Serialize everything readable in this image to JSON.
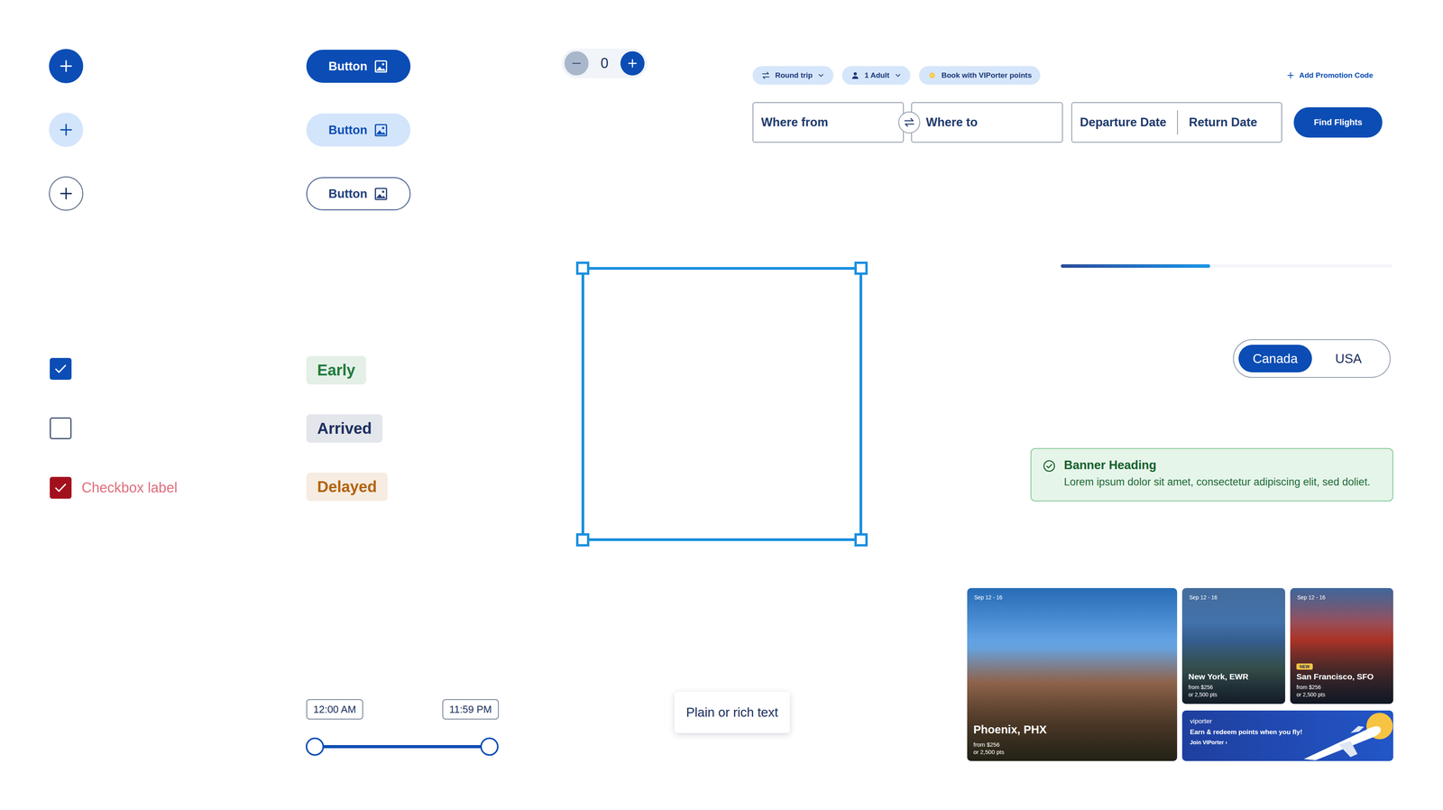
{
  "icon_buttons": [
    {
      "kind": "filled"
    },
    {
      "kind": "tonal"
    },
    {
      "kind": "outlined"
    }
  ],
  "checkboxes": [
    {
      "checked": true,
      "invalid": false,
      "label": ""
    },
    {
      "checked": false,
      "invalid": false,
      "label": ""
    },
    {
      "checked": true,
      "invalid": true,
      "label": "Checkbox label"
    }
  ],
  "buttons": [
    {
      "label": "Button",
      "kind": "filled"
    },
    {
      "label": "Button",
      "kind": "tonal"
    },
    {
      "label": "Button",
      "kind": "outlined"
    }
  ],
  "status_tags": [
    {
      "label": "Early",
      "color": "#1e7a3c"
    },
    {
      "label": "Arrived",
      "color": "#1b2f5e"
    },
    {
      "label": "Delayed",
      "color": "#b3630b"
    }
  ],
  "stepper": {
    "value": "0",
    "decrement_disabled": true
  },
  "time_range": {
    "start": "12:00 AM",
    "end": "11:59 PM",
    "start_level": 0,
    "end_level": 1
  },
  "selection_box": {
    "selected": true
  },
  "tooltip": {
    "text": "Plain or rich text"
  },
  "flight_search": {
    "chips": [
      {
        "label": "Round trip",
        "kind": "trip"
      },
      {
        "label": "1 Adult",
        "kind": "passengers"
      },
      {
        "label": "Book with VIPorter points",
        "kind": "points"
      }
    ],
    "promo": "Add Promotion Code",
    "from": "Where from",
    "to": "Where to",
    "dates": [
      "Departure Date",
      "Return Date"
    ],
    "submit": "Find Flights"
  },
  "progress": {
    "level": 0.45
  },
  "country_toggle": [
    {
      "label": "Canada",
      "selected": true
    },
    {
      "label": "USA",
      "selected": false
    }
  ],
  "banner": {
    "heading": "Banner Heading",
    "body": "Lorem ipsum dolor sit amet, consectetur adipiscing elit, sed doliet."
  },
  "destinations": [
    {
      "kind": "large",
      "dates": "Sep 12 - 16",
      "city": "Phoenix, PHX",
      "price": "from $256",
      "points": "or 2,500 pts",
      "badge": ""
    },
    {
      "kind": "small",
      "dates": "Sep 12 - 16",
      "city": "New York, EWR",
      "price": "from $256",
      "points": "or 2,500 pts",
      "badge": ""
    },
    {
      "kind": "small",
      "dates": "Sep 12 - 16",
      "city": "San Francisco, SFO",
      "price": "from $256",
      "points": "or 2,500 pts",
      "badge": "NEW"
    }
  ],
  "promo_card": {
    "brand": "viporter",
    "text": "Earn & redeem points when you fly!",
    "link": "Join VIPorter ›"
  }
}
